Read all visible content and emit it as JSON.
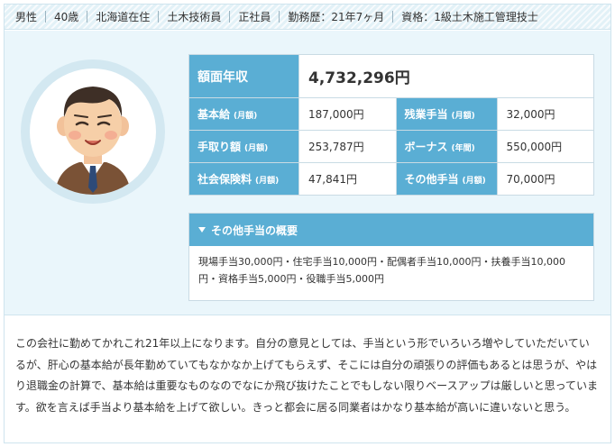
{
  "header": {
    "items": [
      "男性",
      "40歳",
      "北海道在住",
      "土木技術員",
      "正社員",
      "勤務歴：21年7ヶ月",
      "資格：1級土木施工管理技士"
    ]
  },
  "salary": {
    "annual_label": "額面年収",
    "annual_value": "4,732,296円",
    "rows": [
      {
        "l1": "基本給",
        "s1": "(月額)",
        "v1": "187,000円",
        "l2": "残業手当",
        "s2": "(月額)",
        "v2": "32,000円"
      },
      {
        "l1": "手取り額",
        "s1": "(月額)",
        "v1": "253,787円",
        "l2": "ボーナス",
        "s2": "(年間)",
        "v2": "550,000円"
      },
      {
        "l1": "社会保険料",
        "s1": "(月額)",
        "v1": "47,841円",
        "l2": "その他手当",
        "s2": "(月額)",
        "v2": "70,000円"
      }
    ]
  },
  "other_allowance": {
    "title": "その他手当の概要",
    "text": "現場手当30,000円・住宅手当10,000円・配偶者手当10,000円・扶養手当10,000円・資格手当5,000円・役職手当5,000円"
  },
  "comment": "この会社に勤めてかれこれ21年以上になります。自分の意見としては、手当という形でいろいろ増やしていただいているが、肝心の基本給が長年勤めていてもなかなか上げてもらえず、そこには自分の頑張りの評価もあるとは思うが、やはり退職金の計算で、基本給は重要なものなのでなにか飛び抜けたことでもしない限りベースアップは厳しいと思っています。欲を言えば手当より基本給を上げて欲しい。きっと都会に居る同業者はかなり基本給が高いに違いないと思う。",
  "colors": {
    "accent": "#5aaed4",
    "panel_bg": "#eaf6fb",
    "header_bg": "#e2f1f7"
  }
}
